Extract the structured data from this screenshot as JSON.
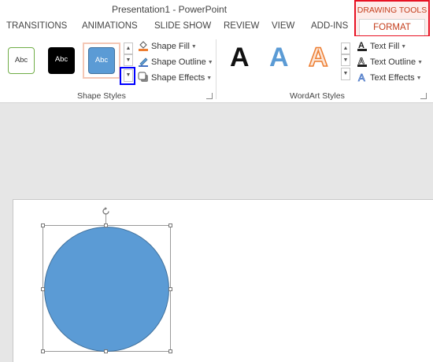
{
  "window": {
    "title": "Presentation1 - PowerPoint"
  },
  "tabs": [
    "TRANSITIONS",
    "ANIMATIONS",
    "SLIDE SHOW",
    "REVIEW",
    "VIEW",
    "ADD-INS"
  ],
  "contextual": {
    "group_label": "DRAWING TOOLS",
    "tab_label": "FORMAT",
    "highlight_color": "#e81123",
    "accent_color": "#c43e1c"
  },
  "ribbon": {
    "shape_styles": {
      "label": "Shape Styles",
      "thumbnails": [
        {
          "text": "Abc",
          "style": "outline-green"
        },
        {
          "text": "Abc",
          "style": "black-fill"
        },
        {
          "text": "Abc",
          "style": "blue-fill",
          "selected": true
        }
      ],
      "commands": [
        "Shape Fill",
        "Shape Outline",
        "Shape Effects"
      ]
    },
    "wordart_styles": {
      "label": "WordArt Styles",
      "letter": "A",
      "commands": [
        "Text Fill",
        "Text Outline",
        "Text Effects"
      ]
    }
  },
  "icons": [
    "fill-bucket-icon",
    "pencil-outline-icon",
    "shape-effects-icon",
    "text-fill-icon",
    "text-outline-icon",
    "text-effects-icon",
    "rotate-handle-icon",
    "more-styles-icon"
  ],
  "colors": {
    "shape_fill": "#5b9bd5",
    "shape_border": "#41719c",
    "more_button_highlight": "#0000ff"
  }
}
